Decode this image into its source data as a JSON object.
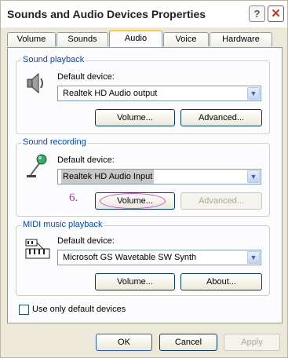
{
  "window": {
    "title": "Sounds and Audio Devices Properties",
    "help_glyph": "?",
    "close_glyph": "✕"
  },
  "tabs": [
    {
      "label": "Volume"
    },
    {
      "label": "Sounds"
    },
    {
      "label": "Audio",
      "active": true
    },
    {
      "label": "Voice"
    },
    {
      "label": "Hardware"
    }
  ],
  "sound_playback": {
    "group_label": "Sound playback",
    "default_device_label": "Default device:",
    "device": "Realtek HD Audio output",
    "volume_button": "Volume...",
    "advanced_button": "Advanced...",
    "icon": "speaker-icon"
  },
  "sound_recording": {
    "group_label": "Sound recording",
    "default_device_label": "Default device:",
    "device": "Realtek HD Audio Input",
    "volume_button": "Volume...",
    "advanced_button": "Advanced...",
    "icon": "microphone-icon"
  },
  "midi_playback": {
    "group_label": "MIDI music playback",
    "default_device_label": "Default device:",
    "device": "Microsoft GS Wavetable SW Synth",
    "volume_button": "Volume...",
    "about_button": "About...",
    "icon": "midi-keyboard-icon"
  },
  "annotation": {
    "step": "6.",
    "color": "#cc22cc"
  },
  "use_default_devices": {
    "label": "Use only default devices",
    "checked": false
  },
  "footer": {
    "ok": "OK",
    "cancel": "Cancel",
    "apply": "Apply"
  }
}
